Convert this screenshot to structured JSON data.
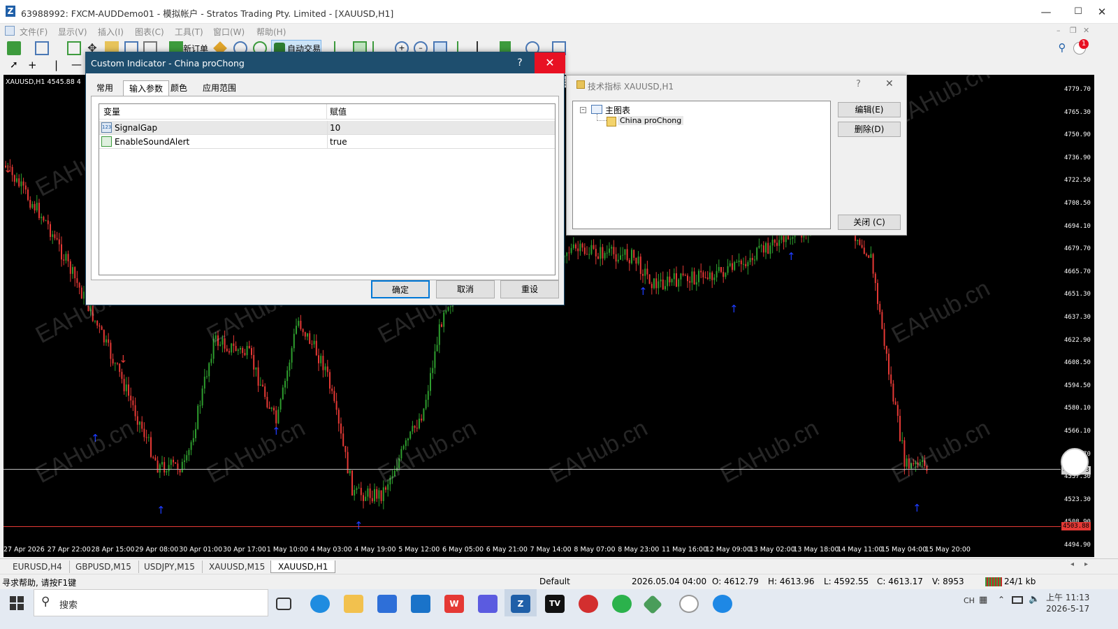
{
  "window": {
    "title": "63988992: FXCM-AUDDemo01 - 模拟帐户 - Stratos Trading Pty. Limited - [XAUUSD,H1]",
    "app_icon": "Z"
  },
  "menu": [
    "文件(F)",
    "显示(V)",
    "插入(I)",
    "图表(C)",
    "工具(T)",
    "窗口(W)",
    "帮助(H)"
  ],
  "toolbar": {
    "new_order": "新订单",
    "auto_trading": "自动交易"
  },
  "chart": {
    "symbol_label": "XAUUSD,H1  4545.88 4",
    "price_labels": [
      "4779.70",
      "4765.30",
      "4750.90",
      "4736.90",
      "4722.50",
      "4708.50",
      "4694.10",
      "4679.70",
      "4665.70",
      "4651.30",
      "4637.30",
      "4622.90",
      "4608.50",
      "4594.50",
      "4580.10",
      "4566.10",
      "4551.70",
      "4537.30",
      "4523.30",
      "4508.90",
      "4494.90"
    ],
    "current_price": "4537.33",
    "red_line_price": "4503.88",
    "time_labels": [
      "27 Apr 2026",
      "27 Apr 22:00",
      "28 Apr 15:00",
      "29 Apr 08:00",
      "30 Apr 01:00",
      "30 Apr 17:00",
      "1 May 10:00",
      "4 May 03:00",
      "4 May 19:00",
      "5 May 12:00",
      "6 May 05:00",
      "6 May 21:00",
      "7 May 14:00",
      "8 May 07:00",
      "8 May 23:00",
      "11 May 16:00",
      "12 May 09:00",
      "13 May 02:00",
      "13 May 18:00",
      "14 May 11:00",
      "15 May 04:00",
      "15 May 20:00"
    ],
    "watermark": "EAHub.cn"
  },
  "dialog_indicator": {
    "title": "Custom Indicator - China proChong",
    "help": "?",
    "close": "✕",
    "tabs": [
      "常用",
      "输入参数",
      "颜色",
      "应用范围"
    ],
    "active_tab": "输入参数",
    "table": {
      "headers": [
        "变量",
        "赋值"
      ],
      "rows": [
        {
          "name": "SignalGap",
          "value": "10"
        },
        {
          "name": "EnableSoundAlert",
          "value": "true"
        }
      ]
    },
    "buttons": {
      "ok": "确定",
      "cancel": "取消",
      "reset": "重设"
    }
  },
  "tooltip": "关闭",
  "dialog_tech": {
    "title": "技术指标 XAUUSD,H1",
    "help": "?",
    "close": "✕",
    "tree_root": "主图表",
    "tree_child": "China proChong",
    "buttons": {
      "edit": "编辑(E)",
      "delete": "删除(D)",
      "close": "关闭 (C)"
    }
  },
  "chart_tabs": [
    "EURUSD,H4",
    "GBPUSD,M15",
    "USDJPY,M15",
    "XAUUSD,M15",
    "XAUUSD,H1"
  ],
  "active_chart_tab": "XAUUSD,H1",
  "status": {
    "help": "寻求帮助, 请按F1键",
    "profile": "Default",
    "datetime": "2026.05.04 04:00",
    "open": "O: 4612.79",
    "high": "H: 4613.96",
    "low": "L: 4592.55",
    "close": "C: 4613.17",
    "volume": "V: 8953",
    "traffic": "24/1 kb"
  },
  "taskbar": {
    "search": "搜索",
    "time": "上午 11:13",
    "date": "2026-5-17",
    "ime": "CH",
    "notification_count": "1"
  }
}
